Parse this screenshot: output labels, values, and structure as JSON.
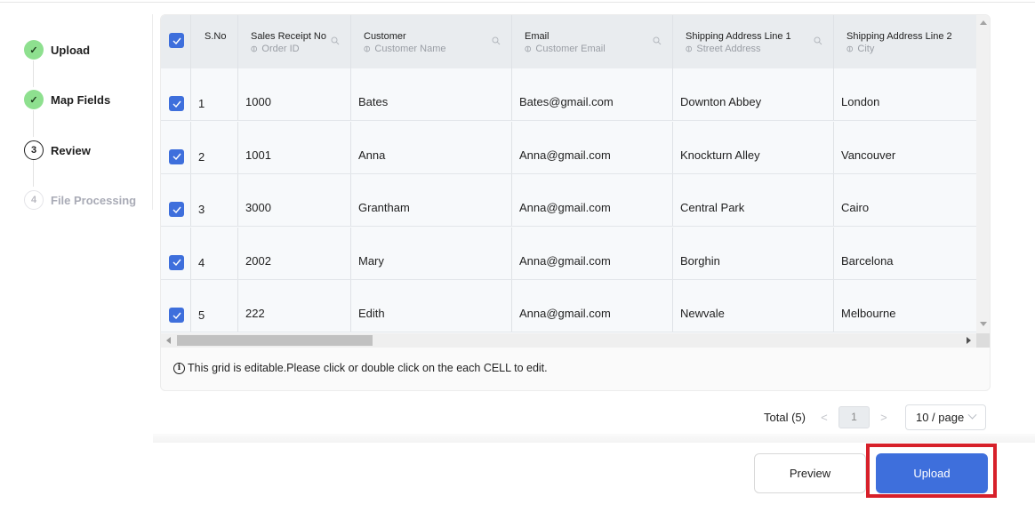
{
  "stepper": {
    "steps": [
      {
        "label": "Upload",
        "state": "done",
        "marker": "✓"
      },
      {
        "label": "Map Fields",
        "state": "done",
        "marker": "✓"
      },
      {
        "label": "Review",
        "state": "current",
        "marker": "3"
      },
      {
        "label": "File Processing",
        "state": "pending",
        "marker": "4"
      }
    ]
  },
  "grid": {
    "columns": [
      {
        "title": "",
        "subtitle": ""
      },
      {
        "title": "S.No",
        "subtitle": ""
      },
      {
        "title": "Sales Receipt No",
        "subtitle": "Order ID"
      },
      {
        "title": "Customer",
        "subtitle": "Customer Name"
      },
      {
        "title": "Email",
        "subtitle": "Customer Email"
      },
      {
        "title": "Shipping Address Line 1",
        "subtitle": "Street Address"
      },
      {
        "title": "Shipping Address Line 2",
        "subtitle": "City"
      }
    ],
    "rows": [
      {
        "sno": "1",
        "receipt": "1000",
        "customer": "Bates",
        "email": "Bates@gmail.com",
        "addr1": "Downton Abbey",
        "addr2": "London",
        "checked": true
      },
      {
        "sno": "2",
        "receipt": "1001",
        "customer": "Anna",
        "email": "Anna@gmail.com",
        "addr1": "Knockturn Alley",
        "addr2": "Vancouver",
        "checked": true
      },
      {
        "sno": "3",
        "receipt": "3000",
        "customer": "Grantham",
        "email": "Anna@gmail.com",
        "addr1": "Central Park",
        "addr2": "Cairo",
        "checked": true
      },
      {
        "sno": "4",
        "receipt": "2002",
        "customer": "Mary",
        "email": "Anna@gmail.com",
        "addr1": "Borghin",
        "addr2": "Barcelona",
        "checked": true
      },
      {
        "sno": "5",
        "receipt": "222",
        "customer": "Edith",
        "email": "Anna@gmail.com",
        "addr1": "Newvale",
        "addr2": "Melbourne",
        "checked": true
      }
    ],
    "info_text": "This grid is editable.Please click or double click on the each CELL to edit.",
    "check_glyph": "✓",
    "link_glyph": "⚯",
    "info_glyph": "i"
  },
  "pagination": {
    "total_label": "Total (5)",
    "prev": "<",
    "current_page": "1",
    "next": ">",
    "page_size": "10 / page"
  },
  "actions": {
    "preview_label": "Preview",
    "upload_label": "Upload"
  },
  "colors": {
    "accent": "#3e6fdc",
    "done": "#8ee08f",
    "highlight": "#d7202a"
  }
}
